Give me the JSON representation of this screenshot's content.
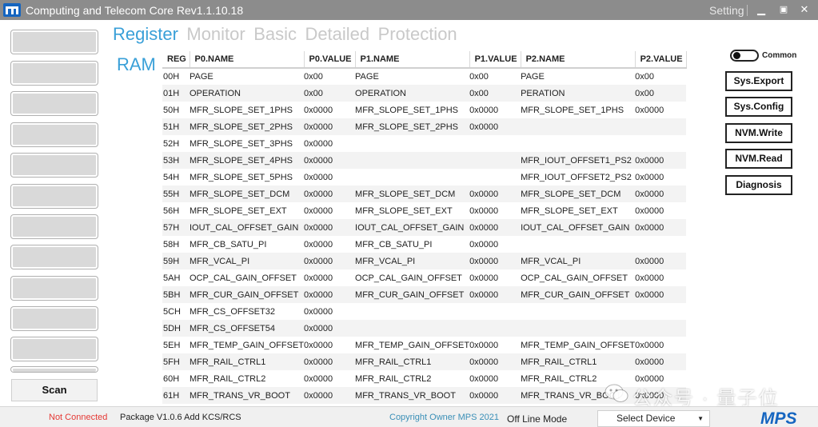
{
  "window": {
    "title": "Computing and Telecom Core Rev1.1.10.18",
    "setting_label": "Setting",
    "minimize_icon": "minimize-icon",
    "maximize_icon": "maximize-icon",
    "close_icon": "close-icon"
  },
  "sidebar": {
    "scan_label": "Scan",
    "button_count_visible": 11
  },
  "tabs": [
    {
      "label": "Register",
      "active": true
    },
    {
      "label": "Monitor",
      "active": false
    },
    {
      "label": "Basic",
      "active": false
    },
    {
      "label": "Detailed",
      "active": false
    },
    {
      "label": "Protection",
      "active": false
    }
  ],
  "sub_tab": {
    "label": "RAM"
  },
  "table": {
    "headers": [
      "REG",
      "P0.NAME",
      "P0.VALUE",
      "P1.NAME",
      "P1.VALUE",
      "P2.NAME",
      "P2.VALUE"
    ],
    "rows": [
      [
        "00H",
        "PAGE",
        "0x00",
        "PAGE",
        "0x00",
        "PAGE",
        "0x00"
      ],
      [
        "01H",
        "OPERATION",
        "0x00",
        "OPERATION",
        "0x00",
        "PERATION",
        "0x00"
      ],
      [
        "50H",
        "MFR_SLOPE_SET_1PHS",
        "0x0000",
        "MFR_SLOPE_SET_1PHS",
        "0x0000",
        "MFR_SLOPE_SET_1PHS",
        "0x0000"
      ],
      [
        "51H",
        "MFR_SLOPE_SET_2PHS",
        "0x0000",
        "MFR_SLOPE_SET_2PHS",
        "0x0000",
        "",
        ""
      ],
      [
        "52H",
        "MFR_SLOPE_SET_3PHS",
        "0x0000",
        "",
        "",
        "",
        ""
      ],
      [
        "53H",
        "MFR_SLOPE_SET_4PHS",
        "0x0000",
        "",
        "",
        "MFR_IOUT_OFFSET1_PS2",
        "0x0000"
      ],
      [
        "54H",
        "MFR_SLOPE_SET_5PHS",
        "0x0000",
        "",
        "",
        "MFR_IOUT_OFFSET2_PS2",
        "0x0000"
      ],
      [
        "55H",
        "MFR_SLOPE_SET_DCM",
        "0x0000",
        "MFR_SLOPE_SET_DCM",
        "0x0000",
        "MFR_SLOPE_SET_DCM",
        "0x0000"
      ],
      [
        "56H",
        "MFR_SLOPE_SET_EXT",
        "0x0000",
        "MFR_SLOPE_SET_EXT",
        "0x0000",
        "MFR_SLOPE_SET_EXT",
        "0x0000"
      ],
      [
        "57H",
        "IOUT_CAL_OFFSET_GAIN",
        "0x0000",
        "IOUT_CAL_OFFSET_GAIN",
        "0x0000",
        "IOUT_CAL_OFFSET_GAIN",
        "0x0000"
      ],
      [
        "58H",
        "MFR_CB_SATU_PI",
        "0x0000",
        "MFR_CB_SATU_PI",
        "0x0000",
        "",
        ""
      ],
      [
        "59H",
        "MFR_VCAL_PI",
        "0x0000",
        "MFR_VCAL_PI",
        "0x0000",
        "MFR_VCAL_PI",
        "0x0000"
      ],
      [
        "5AH",
        "OCP_CAL_GAIN_OFFSET",
        "0x0000",
        "OCP_CAL_GAIN_OFFSET",
        "0x0000",
        "OCP_CAL_GAIN_OFFSET",
        "0x0000"
      ],
      [
        "5BH",
        "MFR_CUR_GAIN_OFFSET",
        "0x0000",
        "MFR_CUR_GAIN_OFFSET",
        "0x0000",
        "MFR_CUR_GAIN_OFFSET",
        "0x0000"
      ],
      [
        "5CH",
        "MFR_CS_OFFSET32",
        "0x0000",
        "",
        "",
        "",
        ""
      ],
      [
        "5DH",
        "MFR_CS_OFFSET54",
        "0x0000",
        "",
        "",
        "",
        ""
      ],
      [
        "5EH",
        "MFR_TEMP_GAIN_OFFSET",
        "0x0000",
        "MFR_TEMP_GAIN_OFFSET",
        "0x0000",
        "MFR_TEMP_GAIN_OFFSET",
        "0x0000"
      ],
      [
        "5FH",
        "MFR_RAIL_CTRL1",
        "0x0000",
        "MFR_RAIL_CTRL1",
        "0x0000",
        "MFR_RAIL_CTRL1",
        "0x0000"
      ],
      [
        "60H",
        "MFR_RAIL_CTRL2",
        "0x0000",
        "MFR_RAIL_CTRL2",
        "0x0000",
        "MFR_RAIL_CTRL2",
        "0x0000"
      ],
      [
        "61H",
        "MFR_TRANS_VR_BOOT",
        "0x0000",
        "MFR_TRANS_VR_BOOT",
        "0x0000",
        "MFR_TRANS_VR_BOOT",
        "0x0000"
      ]
    ]
  },
  "right_panel": {
    "common_label": "Common",
    "common_on": false,
    "actions": [
      "Sys.Export",
      "Sys.Config",
      "NVM.Write",
      "NVM.Read",
      "Diagnosis"
    ]
  },
  "status": {
    "connection": "Not Connected",
    "package": "Package V1.0.6 Add KCS/RCS",
    "copyright": "Copyright Owner MPS 2021",
    "mode": "Off Line Mode",
    "device_select": "Select Device",
    "logo_text": "MPS",
    "colors": {
      "error": "#e53935",
      "accent": "#3aa0d8",
      "brand": "#1565c0"
    }
  },
  "watermark": {
    "text": "公众号 · 量子位",
    "icon": "wechat-icon"
  }
}
